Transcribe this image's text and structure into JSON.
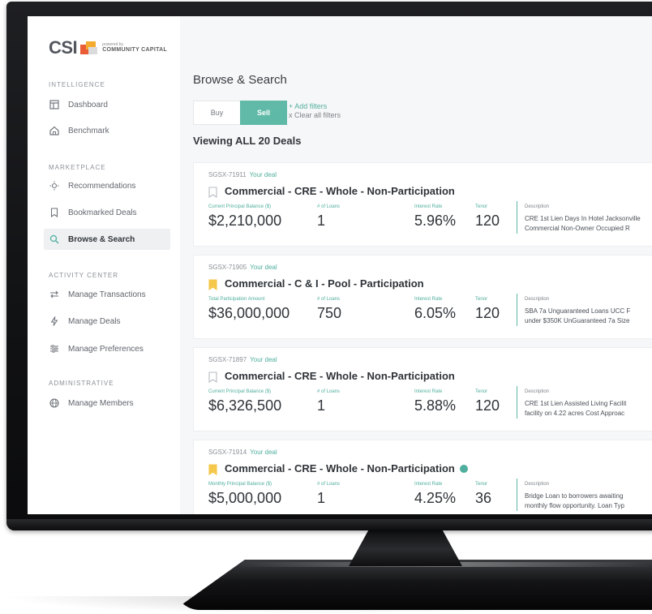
{
  "logo": {
    "brand": "CSI",
    "powered_by": "powered by",
    "company": "COMMUNITY CAPITAL"
  },
  "sidebar": {
    "sections": [
      {
        "label": "INTELLIGENCE",
        "items": [
          {
            "label": "Dashboard",
            "icon": "dashboard-icon"
          },
          {
            "label": "Benchmark",
            "icon": "home-icon"
          }
        ]
      },
      {
        "label": "MARKETPLACE",
        "items": [
          {
            "label": "Recommendations",
            "icon": "lightbulb-icon"
          },
          {
            "label": "Bookmarked Deals",
            "icon": "bookmark-icon"
          },
          {
            "label": "Browse & Search",
            "icon": "search-icon",
            "active": true
          }
        ]
      },
      {
        "label": "ACTIVITY CENTER",
        "items": [
          {
            "label": "Manage Transactions",
            "icon": "transfer-icon"
          },
          {
            "label": "Manage Deals",
            "icon": "bolt-icon"
          },
          {
            "label": "Manage Preferences",
            "icon": "sliders-icon"
          }
        ]
      },
      {
        "label": "ADMINISTRATIVE",
        "items": [
          {
            "label": "Manage Members",
            "icon": "globe-icon"
          }
        ]
      }
    ]
  },
  "main": {
    "title": "Browse & Search",
    "toggle": {
      "buy": "Buy",
      "sell": "Sell",
      "selected": "Sell"
    },
    "filters": {
      "add": "+ Add filters",
      "clear": "x Clear all filters"
    },
    "viewing": "Viewing ALL 20 Deals",
    "deals": [
      {
        "ref": "SGSX-71911",
        "tag": "Your deal",
        "bookmarked": false,
        "title": "Commercial - CRE - Whole - Non-Participation",
        "badge": false,
        "amount_label": "Current Principal Balance ($)",
        "amount": "$2,210,000",
        "loans_label": "# of Loans",
        "loans": "1",
        "rate_label": "Interest Rate",
        "rate": "5.96%",
        "tenor_label": "Tenor",
        "tenor": "120",
        "desc_label": "Description",
        "desc_line1": "CRE 1st Lien Days In Hotel Jacksonville",
        "desc_line2": "Commercial Non-Owner Occupied R"
      },
      {
        "ref": "SGSX-71905",
        "tag": "Your deal",
        "bookmarked": true,
        "title": "Commercial - C & I - Pool - Participation",
        "badge": false,
        "amount_label": "Total Participation Amount",
        "amount": "$36,000,000",
        "loans_label": "# of Loans",
        "loans": "750",
        "rate_label": "Interest Rate",
        "rate": "6.05%",
        "tenor_label": "Tenor",
        "tenor": "120",
        "desc_label": "Description",
        "desc_line1": "SBA 7a Unguaranteed Loans UCC F",
        "desc_line2": "under $350K UnGuaranteed 7a Size"
      },
      {
        "ref": "SGSX-71897",
        "tag": "Your deal",
        "bookmarked": false,
        "title": "Commercial - CRE - Whole - Non-Participation",
        "badge": false,
        "amount_label": "Current Principal Balance ($)",
        "amount": "$6,326,500",
        "loans_label": "# of Loans",
        "loans": "1",
        "rate_label": "Interest Rate",
        "rate": "5.88%",
        "tenor_label": "Tenor",
        "tenor": "120",
        "desc_label": "Description",
        "desc_line1": "CRE 1st Lien Assisted Living Facilit",
        "desc_line2": "facility on 4.22 acres Cost Approac"
      },
      {
        "ref": "SGSX-71914",
        "tag": "Your deal",
        "bookmarked": true,
        "title": "Commercial - CRE - Whole - Non-Participation",
        "badge": true,
        "amount_label": "Monthly Principal Balance ($)",
        "amount": "$5,000,000",
        "loans_label": "# of Loans",
        "loans": "1",
        "rate_label": "Interest Rate",
        "rate": "4.25%",
        "tenor_label": "Tenor",
        "tenor": "36",
        "desc_label": "Description",
        "desc_line1": "Bridge Loan to borrowers awaiting",
        "desc_line2": "monthly flow opportunity. Loan Typ"
      }
    ]
  },
  "colors": {
    "accent": "#5cb8a5",
    "bookmark": "#f5c84c",
    "text": "#2f3338"
  }
}
